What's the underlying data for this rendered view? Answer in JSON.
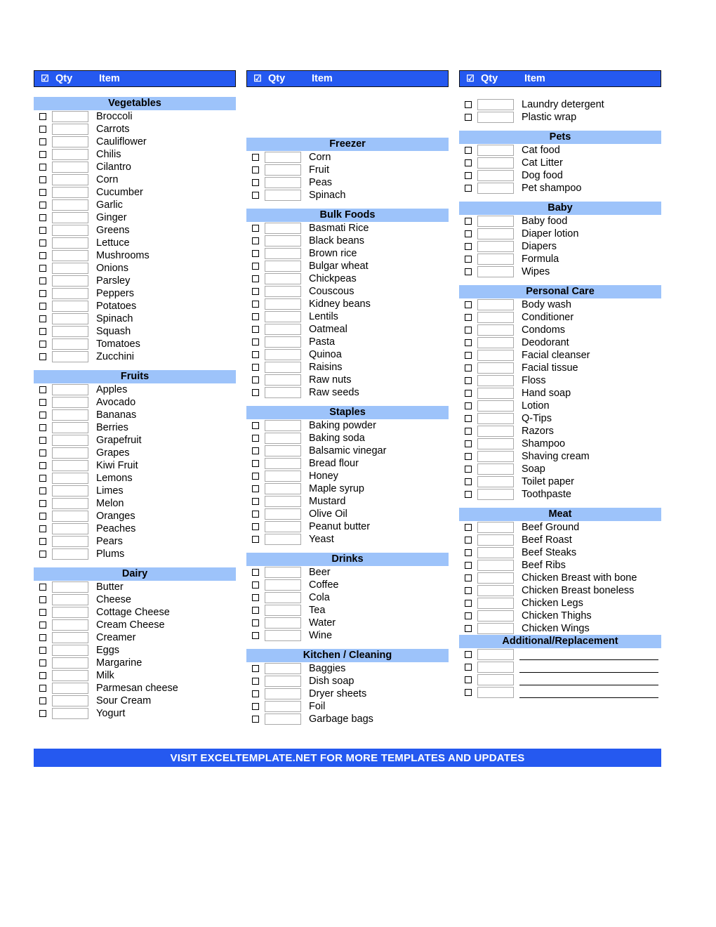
{
  "header": {
    "checkbox_icon": "checked-box-icon",
    "qty_label": "Qty",
    "item_label": "Item"
  },
  "footer": {
    "text": "VISIT EXCELTEMPLATE.NET FOR MORE TEMPLATES AND UPDATES"
  },
  "colors": {
    "header_bar": "#2559f0",
    "section_title": "#9dc3fa",
    "footer_bar": "#2559f0"
  },
  "columns": [
    {
      "sections": [
        {
          "title": "Vegetables",
          "items": [
            "Broccoli",
            "Carrots",
            "Cauliflower",
            "Chilis",
            "Cilantro",
            "Corn",
            "Cucumber",
            "Garlic",
            "Ginger",
            "Greens",
            "Lettuce",
            "Mushrooms",
            "Onions",
            "Parsley",
            "Peppers",
            "Potatoes",
            "Spinach",
            "Squash",
            "Tomatoes",
            "Zucchini"
          ]
        },
        {
          "title": "Fruits",
          "items": [
            "Apples",
            "Avocado",
            "Bananas",
            "Berries",
            "Grapefruit",
            "Grapes",
            "Kiwi Fruit",
            "Lemons",
            "Limes",
            "Melon",
            "Oranges",
            "Peaches",
            "Pears",
            "Plums"
          ]
        },
        {
          "title": "Dairy",
          "items": [
            "Butter",
            "Cheese",
            "Cottage Cheese",
            "Cream Cheese",
            "Creamer",
            "Eggs",
            "Margarine",
            "Milk",
            "Parmesan cheese",
            "Sour Cream",
            "Yogurt"
          ]
        }
      ]
    },
    {
      "sections": [
        {
          "title": "Freezer",
          "items": [
            "Corn",
            "Fruit",
            "Peas",
            "Spinach"
          ]
        },
        {
          "title": "Bulk Foods",
          "items": [
            "Basmati Rice",
            "Black beans",
            "Brown rice",
            "Bulgar wheat",
            "Chickpeas",
            "Couscous",
            "Kidney beans",
            "Lentils",
            "Oatmeal",
            "Pasta",
            "Quinoa",
            "Raisins",
            "Raw nuts",
            "Raw seeds"
          ]
        },
        {
          "title": "Staples",
          "items": [
            "Baking powder",
            "Baking soda",
            "Balsamic vinegar",
            "Bread flour",
            "Honey",
            "Maple syrup",
            "Mustard",
            "Olive Oil",
            "Peanut butter",
            "Yeast"
          ]
        },
        {
          "title": "Drinks",
          "items": [
            "Beer",
            "Coffee",
            "Cola",
            "Tea",
            "Water",
            "Wine"
          ]
        },
        {
          "title": "Kitchen / Cleaning",
          "items": [
            "Baggies",
            "Dish soap",
            "Dryer sheets",
            "Foil",
            "Garbage bags"
          ]
        }
      ]
    },
    {
      "sections": [
        {
          "title": "",
          "items": [
            "Laundry detergent",
            "Plastic wrap"
          ]
        },
        {
          "title": "Pets",
          "items": [
            "Cat food",
            "Cat Litter",
            "Dog food",
            "Pet shampoo"
          ]
        },
        {
          "title": "Baby",
          "items": [
            "Baby food",
            "Diaper lotion",
            "Diapers",
            "Formula",
            "Wipes"
          ]
        },
        {
          "title": "Personal Care",
          "items": [
            "Body wash",
            "Conditioner",
            "Condoms",
            "Deodorant",
            "Facial cleanser",
            "Facial tissue",
            "Floss",
            "Hand soap",
            "Lotion",
            "Q-Tips",
            "Razors",
            "Shampoo",
            "Shaving cream",
            "Soap",
            "Toilet paper",
            "Toothpaste"
          ]
        },
        {
          "title": "Meat",
          "items": [
            "Beef Ground",
            "Beef Roast",
            "Beef Steaks",
            "Beef Ribs",
            "Chicken Breast with bone",
            "Chicken Breast boneless",
            "Chicken Legs",
            "Chicken Thighs",
            "Chicken Wings"
          ]
        },
        {
          "title": "Additional/Replacement",
          "items": [
            "",
            "",
            "",
            ""
          ],
          "blank_lines": true
        }
      ]
    }
  ]
}
